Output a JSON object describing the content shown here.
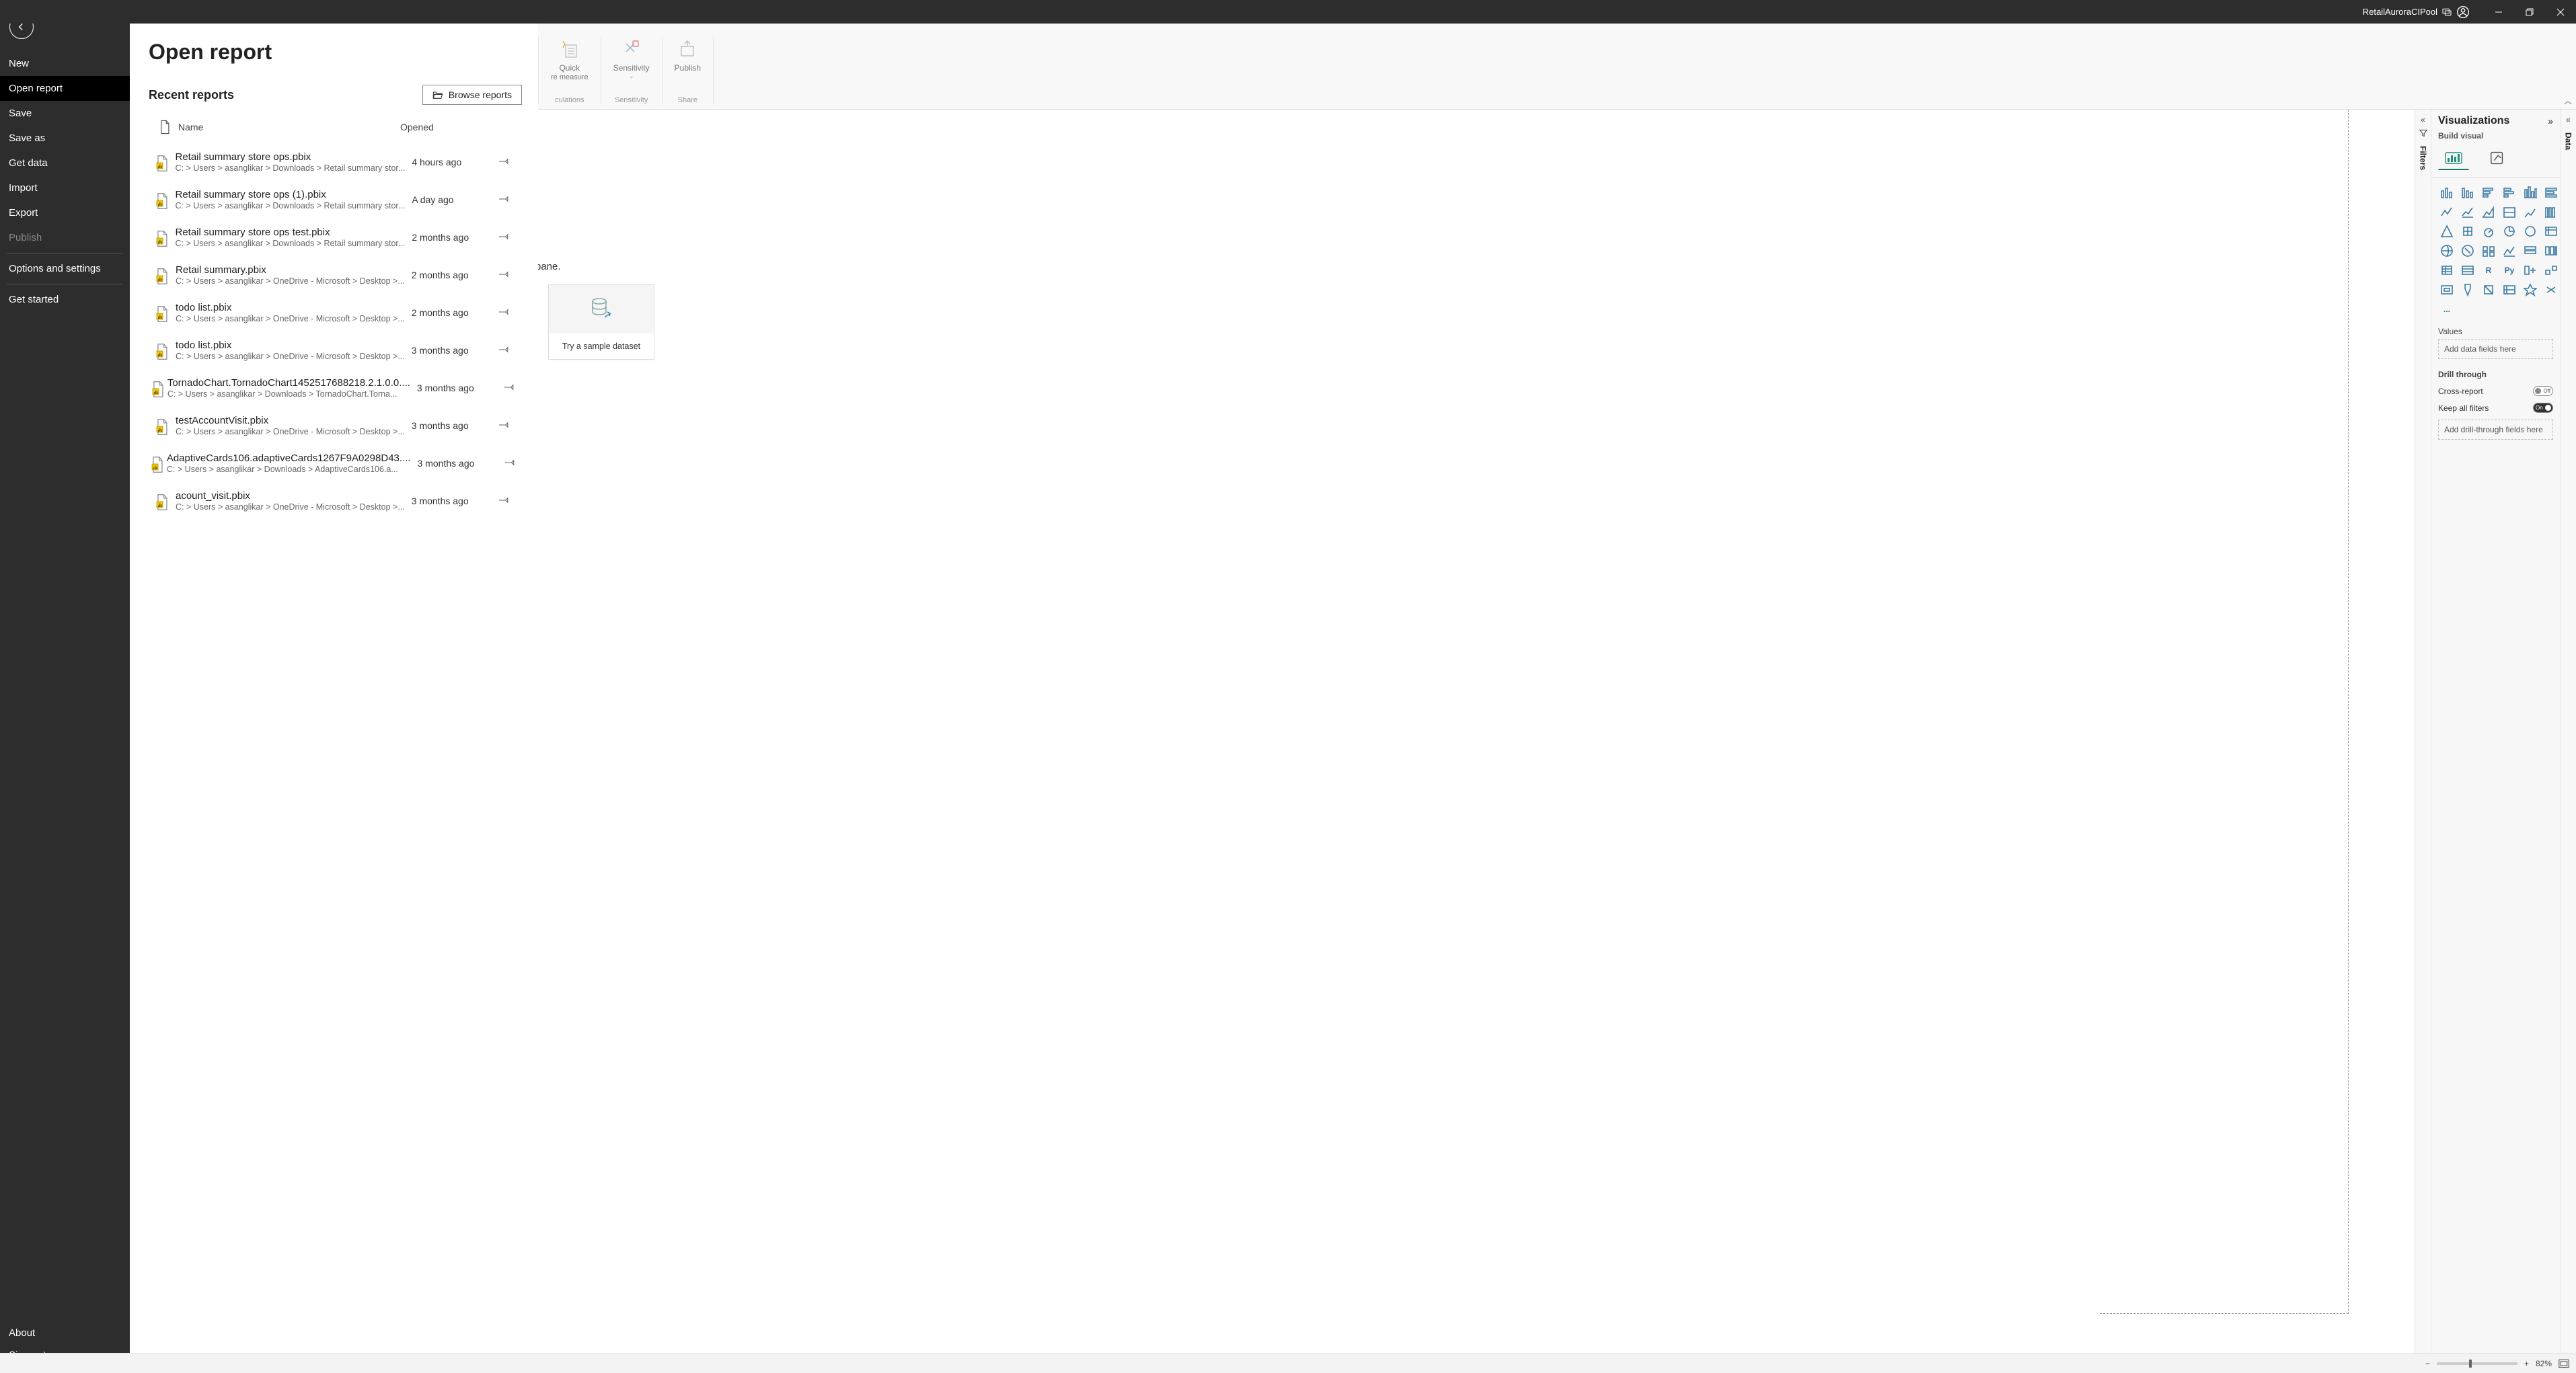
{
  "titlebar": {
    "account": "RetailAuroraCIPool"
  },
  "nav": {
    "items": [
      {
        "label": "New",
        "key": "new",
        "state": ""
      },
      {
        "label": "Open report",
        "key": "open-report",
        "state": "active"
      },
      {
        "label": "Save",
        "key": "save",
        "state": ""
      },
      {
        "label": "Save as",
        "key": "save-as",
        "state": ""
      },
      {
        "label": "Get data",
        "key": "get-data",
        "state": ""
      },
      {
        "label": "Import",
        "key": "import",
        "state": ""
      },
      {
        "label": "Export",
        "key": "export",
        "state": ""
      },
      {
        "label": "Publish",
        "key": "publish",
        "state": "disabled"
      },
      {
        "label": "Options and settings",
        "key": "options",
        "state": ""
      },
      {
        "label": "Get started",
        "key": "get-started",
        "state": ""
      }
    ],
    "about": "About",
    "signout": "Sign out"
  },
  "stage": {
    "title": "Open report",
    "recent_title": "Recent reports",
    "browse": "Browse reports",
    "col_name": "Name",
    "col_opened": "Opened",
    "rows": [
      {
        "name": "Retail summary store ops.pbix",
        "path": "C: > Users > asanglikar > Downloads > Retail summary stor...",
        "opened": "4 hours ago"
      },
      {
        "name": "Retail summary store ops (1).pbix",
        "path": "C: > Users > asanglikar > Downloads > Retail summary stor...",
        "opened": "A day ago"
      },
      {
        "name": "Retail summary store ops test.pbix",
        "path": "C: > Users > asanglikar > Downloads > Retail summary stor...",
        "opened": "2 months ago"
      },
      {
        "name": "Retail summary.pbix",
        "path": "C: > Users > asanglikar > OneDrive - Microsoft > Desktop >...",
        "opened": "2 months ago"
      },
      {
        "name": "todo list.pbix",
        "path": "C: > Users > asanglikar > OneDrive - Microsoft > Desktop >...",
        "opened": "2 months ago"
      },
      {
        "name": "todo list.pbix",
        "path": "C: > Users > asanglikar > OneDrive - Microsoft > Desktop >...",
        "opened": "3 months ago"
      },
      {
        "name": "TornadoChart.TornadoChart1452517688218.2.1.0.0....",
        "path": "C: > Users > asanglikar > Downloads > TornadoChart.Torna...",
        "opened": "3 months ago"
      },
      {
        "name": "testAccountVisit.pbix",
        "path": "C: > Users > asanglikar > OneDrive - Microsoft > Desktop >...",
        "opened": "3 months ago"
      },
      {
        "name": "AdaptiveCards106.adaptiveCards1267F9A0298D43....",
        "path": "C: > Users > asanglikar > Downloads > AdaptiveCards106.a...",
        "opened": "3 months ago"
      },
      {
        "name": "acount_visit.pbix",
        "path": "C: > Users > asanglikar > OneDrive - Microsoft > Desktop >...",
        "opened": "3 months ago"
      }
    ]
  },
  "ribbon": {
    "quick": "Quick",
    "quick_sub": "re measure",
    "sensitivity": "Sensitivity",
    "publish": "Publish",
    "g_calc": "culations",
    "g_sens": "Sensitivity",
    "g_share": "Share"
  },
  "canvas": {
    "sample": "Try a sample dataset",
    "pane_text": "pane."
  },
  "viz": {
    "title": "Visualizations",
    "sub": "Build visual",
    "filters": "Filters",
    "data": "Data",
    "values": "Values",
    "values_ph": "Add data fields here",
    "drill": "Drill through",
    "cross": "Cross-report",
    "cross_state": "Off",
    "keep": "Keep all filters",
    "keep_state": "On",
    "drill_ph": "Add drill-through fields here"
  },
  "status": {
    "zoom": "82%"
  }
}
